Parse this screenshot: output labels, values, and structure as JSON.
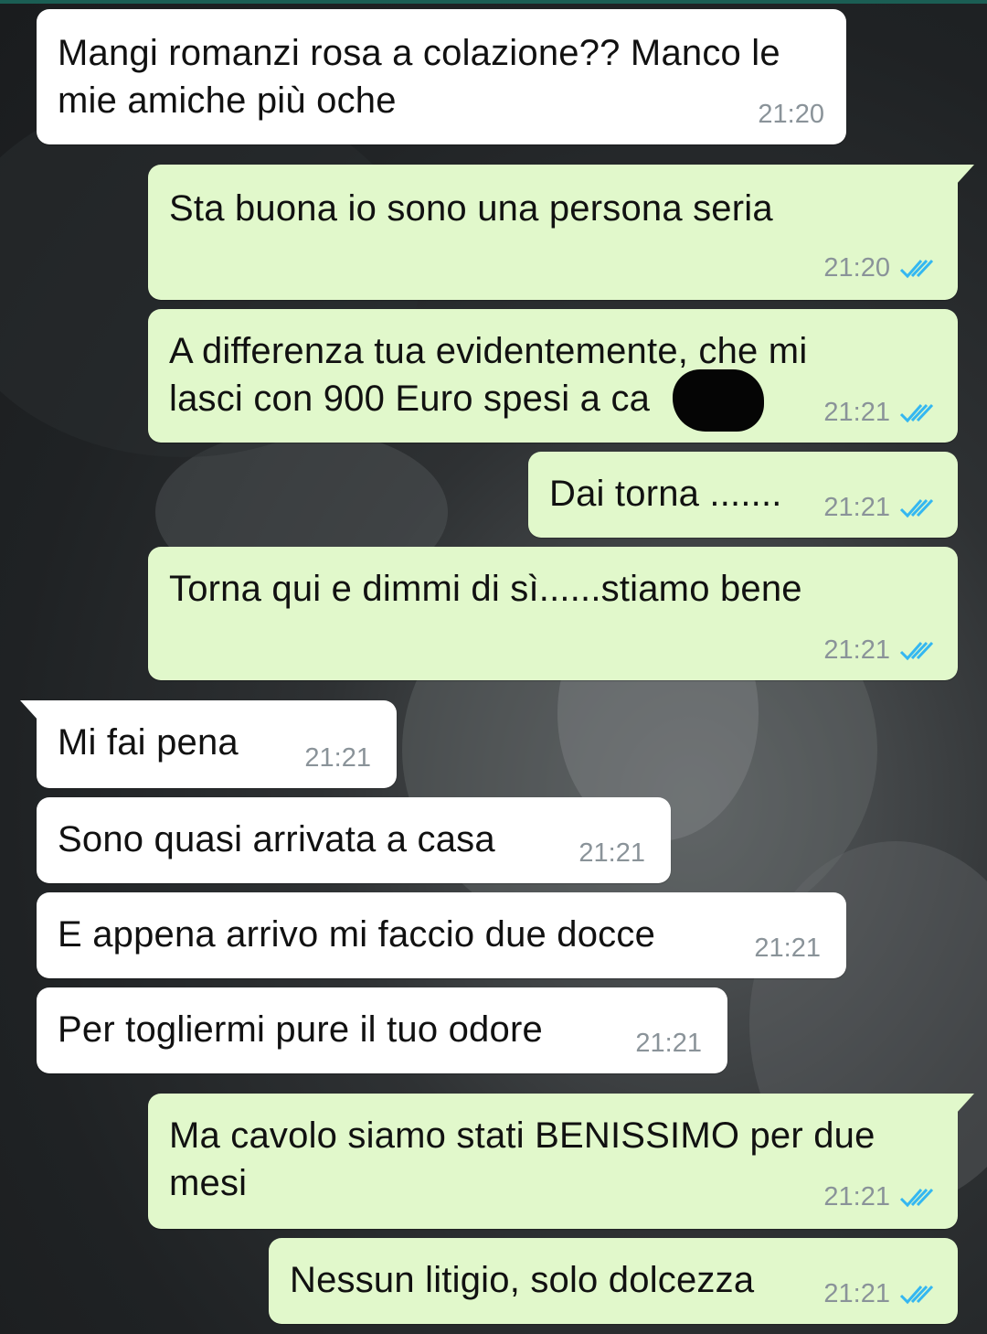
{
  "messages": [
    {
      "text": "Mangi romanzi rosa a colazione?? Manco le mie amiche più oche",
      "time": "21:20",
      "direction": "in"
    },
    {
      "text": "Sta buona io sono una persona seria",
      "time": "21:20",
      "direction": "out",
      "status": "read"
    },
    {
      "text": "A differenza tua evidentemente, che mi lasci con 900 Euro spesi a ca",
      "time": "21:21",
      "direction": "out",
      "status": "read"
    },
    {
      "text": "Dai torna .......",
      "time": "21:21",
      "direction": "out",
      "status": "read"
    },
    {
      "text": "Torna qui e dimmi di sì......stiamo bene",
      "time": "21:21",
      "direction": "out",
      "status": "read"
    },
    {
      "text": "Mi fai pena",
      "time": "21:21",
      "direction": "in"
    },
    {
      "text": "Sono quasi arrivata a casa",
      "time": "21:21",
      "direction": "in"
    },
    {
      "text": "E appena arrivo mi faccio due docce",
      "time": "21:21",
      "direction": "in"
    },
    {
      "text": "Per togliermi pure il tuo odore",
      "time": "21:21",
      "direction": "in"
    },
    {
      "text": "Ma cavolo siamo stati BENISSIMO per due mesi",
      "time": "21:21",
      "direction": "out",
      "status": "read"
    },
    {
      "text": "Nessun litigio, solo dolcezza",
      "time": "21:21",
      "direction": "out",
      "status": "read"
    }
  ],
  "colors": {
    "incoming_bubble": "#ffffff",
    "outgoing_bubble": "#e1f8cb",
    "read_ticks": "#34b7f1",
    "timestamp": "#8a9399"
  },
  "icons": {
    "read_receipt": "double-check-icon",
    "redaction": "redaction-mark"
  }
}
